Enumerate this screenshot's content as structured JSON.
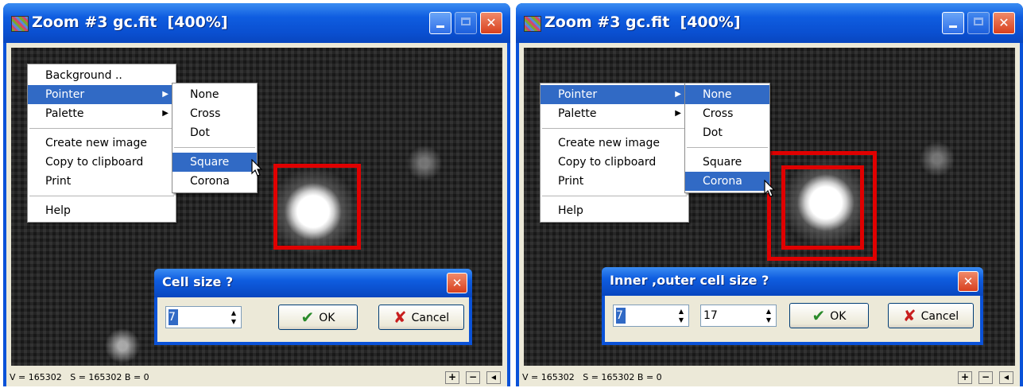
{
  "colors": {
    "title_bar": "#0a52d8",
    "highlight": "#316ac5",
    "marker": "#e00000",
    "face": "#ece9d8"
  },
  "window1": {
    "title": "Zoom #3 gc.fit  [400%]",
    "context_menu": [
      {
        "label": "Background .."
      },
      {
        "label": "Pointer",
        "submenu": true
      },
      {
        "label": "Palette",
        "submenu": true
      },
      {
        "label": "Create new image"
      },
      {
        "label": "Copy to clipboard"
      },
      {
        "label": "Print"
      },
      {
        "label": "Help"
      }
    ],
    "pointer_menu": [
      {
        "label": "None"
      },
      {
        "label": "Cross"
      },
      {
        "label": "Dot"
      },
      {
        "label": "Square",
        "selected": true
      },
      {
        "label": "Corona"
      }
    ],
    "dialog": {
      "title": "Cell size ?",
      "value1": "7",
      "ok_label": "OK",
      "cancel_label": "Cancel"
    },
    "status": "V = 165302   S = 165302 B = 0",
    "status_buttons": [
      "+",
      "−",
      "◂"
    ]
  },
  "window2": {
    "title": "Zoom #3 gc.fit  [400%]",
    "context_menu": [
      {
        "label": "Pointer",
        "submenu": true
      },
      {
        "label": "Palette",
        "submenu": true
      },
      {
        "label": "Create new image"
      },
      {
        "label": "Copy to clipboard"
      },
      {
        "label": "Print"
      },
      {
        "label": "Help"
      }
    ],
    "pointer_menu": [
      {
        "label": "None"
      },
      {
        "label": "Cross"
      },
      {
        "label": "Dot"
      },
      {
        "label": "Square"
      },
      {
        "label": "Corona",
        "selected": true
      }
    ],
    "dialog": {
      "title": "Inner ,outer cell size ?",
      "value1": "7",
      "value2": "17",
      "ok_label": "OK",
      "cancel_label": "Cancel"
    },
    "status": "V = 165302   S = 165302 B = 0",
    "status_buttons": [
      "+",
      "−",
      "◂"
    ]
  }
}
